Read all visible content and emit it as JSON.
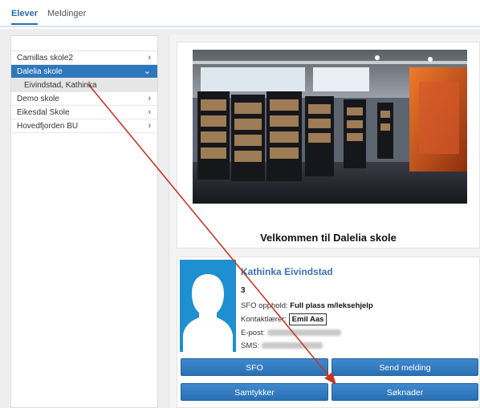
{
  "topnav": {
    "tabs": [
      {
        "label": "Elever",
        "active": true
      },
      {
        "label": "Meldinger",
        "active": false
      }
    ]
  },
  "sidebar": {
    "items": [
      {
        "label": "Camillas skole2",
        "chevron": "›"
      },
      {
        "label": "Dalelia skole",
        "chevron": "⌄",
        "selected": true
      },
      {
        "label": "Eivindstad, Kathinka",
        "sub": true
      },
      {
        "label": "Demo skole",
        "chevron": "›"
      },
      {
        "label": "Eikesdal Skole",
        "chevron": "›"
      },
      {
        "label": "Hovedfjorden BU",
        "chevron": "›"
      }
    ]
  },
  "welcome": {
    "title": "Velkommen til Dalelia skole"
  },
  "student": {
    "name": "Kathinka Eivindstad",
    "grade": "3",
    "sfo_label": "SFO opphold:",
    "sfo_value": "Full plass m/leksehjelp",
    "teacher_label": "Kontaktlærer:",
    "teacher_value": "Emil Aas",
    "email_label": "E-post:",
    "sms_label": "SMS:"
  },
  "buttons": {
    "sfo": "SFO",
    "send_message": "Send melding",
    "consent": "Samtykker",
    "applications": "Søknader"
  },
  "colors": {
    "primary": "#2d78bc",
    "link": "#3a74b3",
    "annotation_arrow": "#c0392b",
    "avatar_bg": "#1e8fd0"
  },
  "icons": {
    "chevron_right": "chevron-right-icon",
    "chevron_down": "chevron-down-icon",
    "avatar": "person-silhouette-icon"
  }
}
